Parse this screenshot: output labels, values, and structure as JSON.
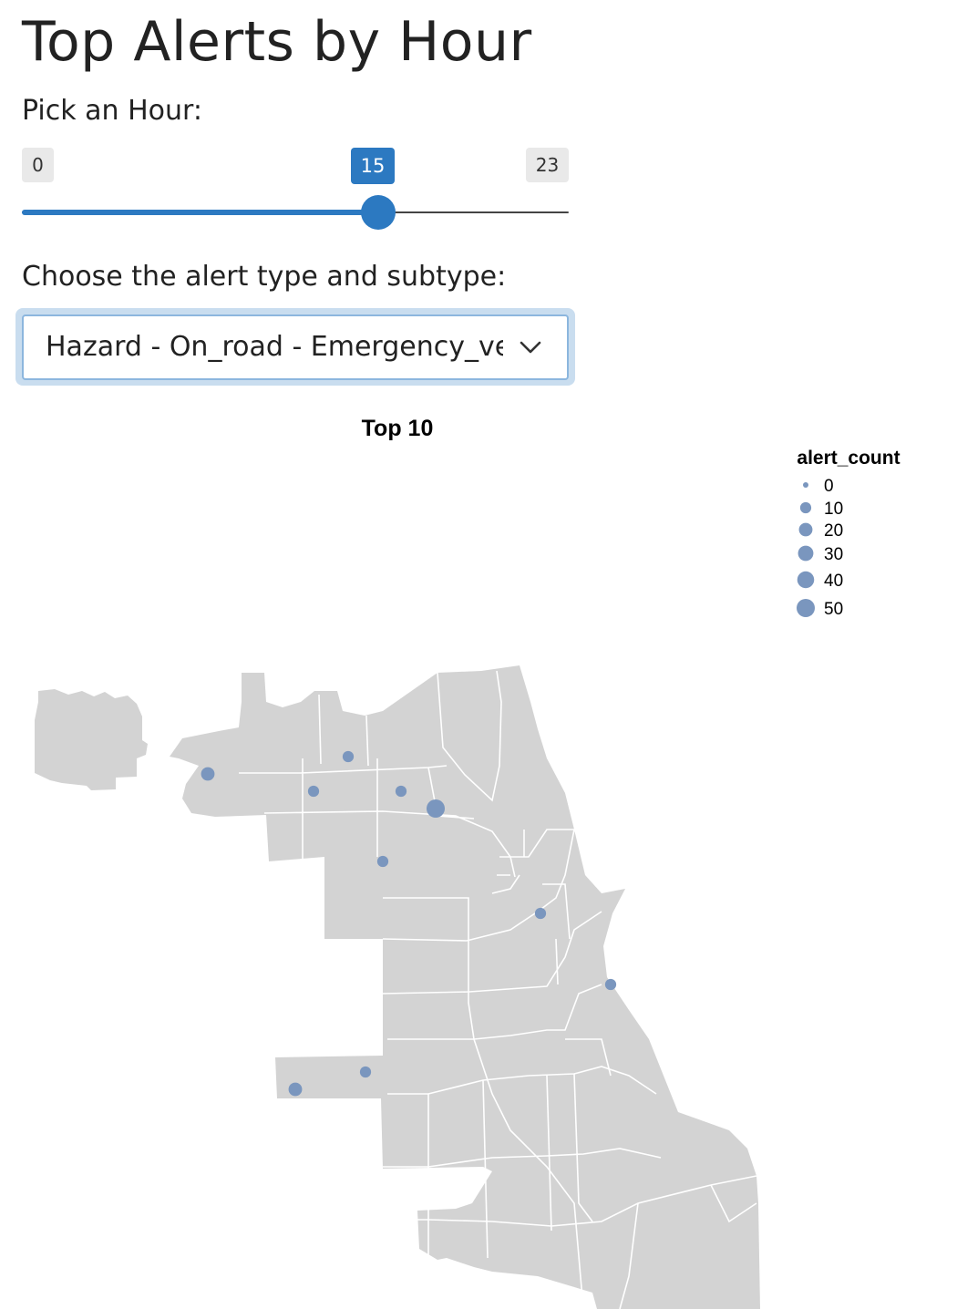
{
  "page": {
    "title": "Top Alerts by Hour"
  },
  "hour_input": {
    "label": "Pick an Hour:",
    "min": "0",
    "max": "23",
    "value": "15",
    "level": 15
  },
  "alert_type_input": {
    "label": "Choose the alert type and subtype:",
    "selected": "Hazard - On_road - Emergency_vehicle"
  },
  "chart_data": {
    "type": "scatter",
    "title": "Top 10",
    "legend": {
      "title": "alert_count",
      "placement": "top-right",
      "entries": [
        {
          "label": "0",
          "value": 0
        },
        {
          "label": "10",
          "value": 10
        },
        {
          "label": "20",
          "value": 20
        },
        {
          "label": "30",
          "value": 30
        },
        {
          "label": "40",
          "value": 40
        },
        {
          "label": "50",
          "value": 50
        }
      ]
    },
    "point_color": "#7a96be",
    "basemap_color": "#d3d3d3",
    "points": [
      {
        "alert_count": 20
      },
      {
        "alert_count": 10
      },
      {
        "alert_count": 10
      },
      {
        "alert_count": 10
      },
      {
        "alert_count": 50
      },
      {
        "alert_count": 10
      },
      {
        "alert_count": 10
      },
      {
        "alert_count": 10
      },
      {
        "alert_count": 10
      },
      {
        "alert_count": 20
      }
    ]
  }
}
